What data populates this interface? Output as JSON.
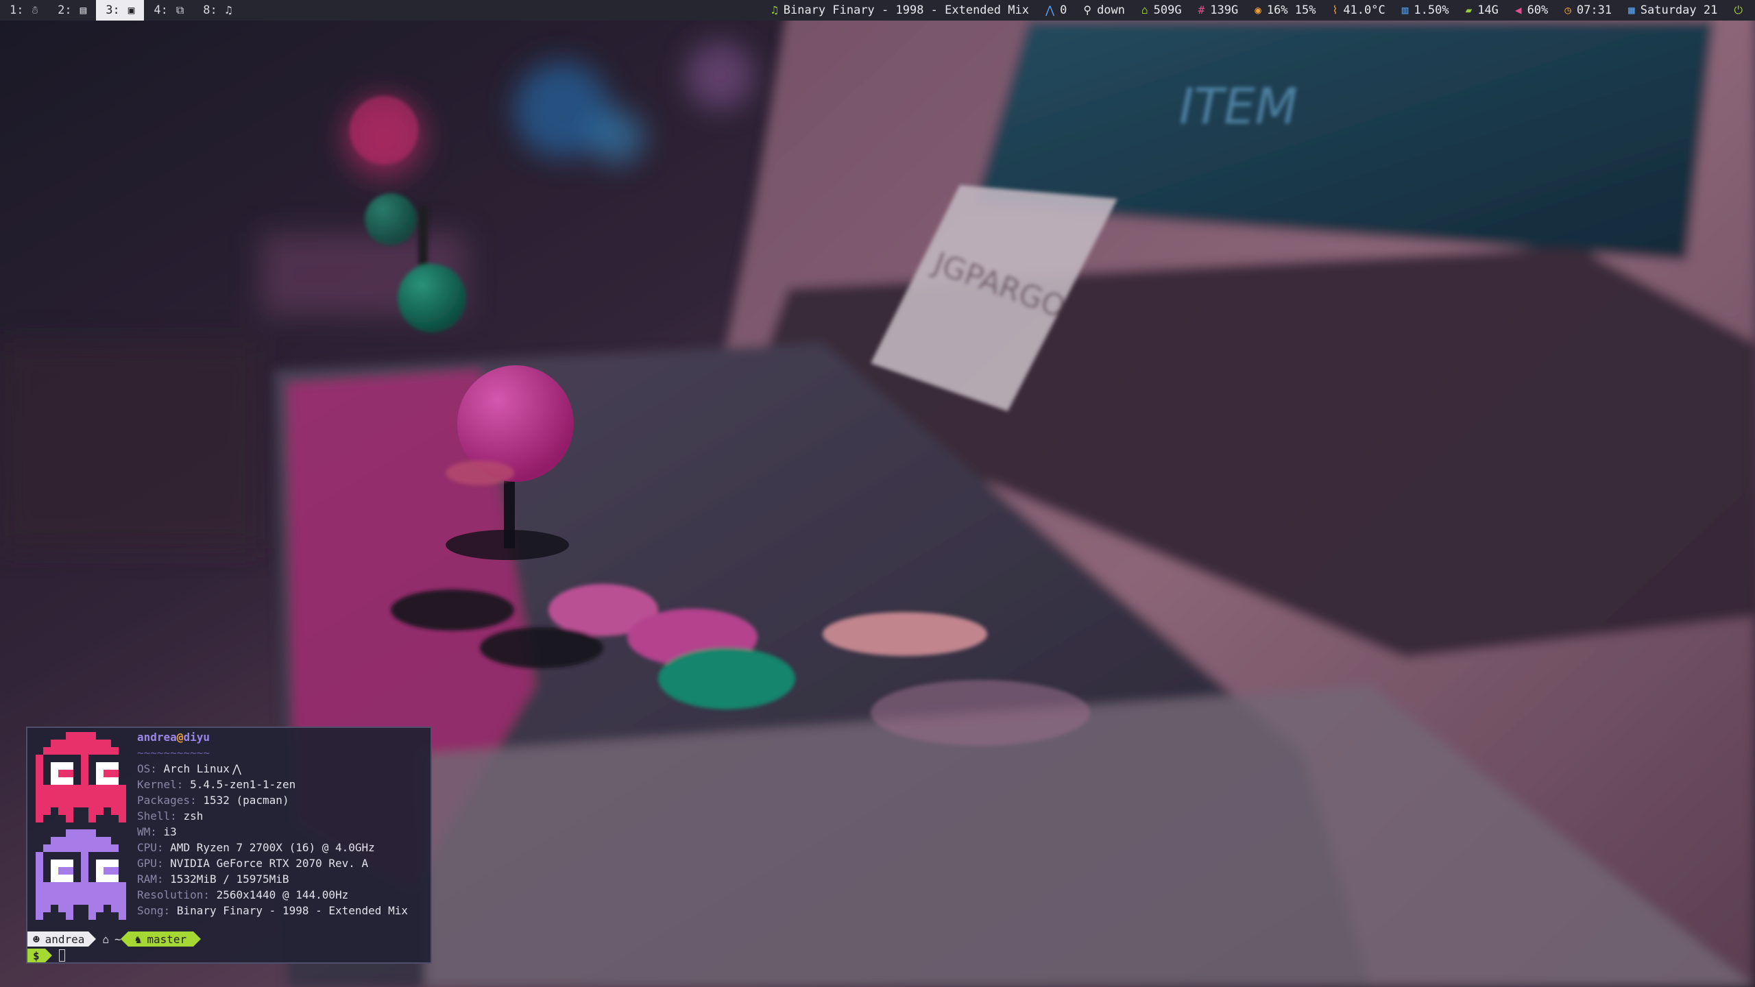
{
  "bar": {
    "workspaces": [
      {
        "label": "1:",
        "icon": "ghost-icon",
        "glyph": "☃",
        "focused": false
      },
      {
        "label": "2:",
        "icon": "document-icon",
        "glyph": "▤",
        "focused": false
      },
      {
        "label": "3:",
        "icon": "terminal-icon",
        "glyph": "▣",
        "focused": true
      },
      {
        "label": "4:",
        "icon": "copy-icon",
        "glyph": "⧉",
        "focused": false
      },
      {
        "label": "8:",
        "icon": "music-note-icon",
        "glyph": "♫",
        "focused": false
      }
    ],
    "status": {
      "song": "Binary Finary - 1998 - Extended Mix",
      "updates": "0",
      "network": "down",
      "disk_root": "509G",
      "disk_home": "139G",
      "cpu": "16% 15%",
      "temperature": "41.0°C",
      "load": "1.50%",
      "memory": "14G",
      "volume": "60%",
      "time": "07:31",
      "date": "Saturday 21"
    },
    "icons": {
      "song": "♫",
      "updates": "⋀",
      "network": "⚲",
      "disk_root": "⌂",
      "disk_home": "#",
      "cpu": "◉",
      "temperature": "⌇",
      "load": "▥",
      "memory": "▰",
      "volume": "◀",
      "time": "◷",
      "date": "▦",
      "power": "⏻"
    },
    "colors": {
      "song": "#9acb3c",
      "updates": "#5aa0e8",
      "network": "#e8e8ec",
      "disk_root": "#9acb3c",
      "disk_home": "#e05090",
      "cpu": "#f0a030",
      "temperature": "#f0a030",
      "load": "#5aa0e8",
      "memory": "#9acb3c",
      "volume": "#e05090",
      "time": "#f0a030",
      "date": "#5aa0e8",
      "power": "#9acb3c"
    }
  },
  "terminal": {
    "user": "andrea",
    "at": "@",
    "host": "diyu",
    "separator": "~~~~~~~~~~~",
    "info": [
      {
        "key": "OS:",
        "value": "Arch Linux"
      },
      {
        "key": "Kernel:",
        "value": "5.4.5-zen1-1-zen"
      },
      {
        "key": "Packages:",
        "value": "1532 (pacman)"
      },
      {
        "key": "Shell:",
        "value": "zsh"
      },
      {
        "key": "WM:",
        "value": "i3"
      },
      {
        "key": "CPU:",
        "value": "AMD Ryzen 7 2700X (16) @ 4.0GHz"
      },
      {
        "key": "GPU:",
        "value": "NVIDIA GeForce RTX 2070 Rev. A"
      },
      {
        "key": "RAM:",
        "value": "1532MiB / 15975MiB"
      },
      {
        "key": "Resolution:",
        "value": "2560x1440 @ 144.00Hz"
      },
      {
        "key": "Song:",
        "value": "Binary Finary - 1998 - Extended Mix"
      }
    ],
    "arch_glyph": "⋀",
    "prompt": {
      "user": "andrea",
      "user_glyph": "☻",
      "dir_glyph": "⌂",
      "dir": "~",
      "git_glyph": "♞",
      "branch": "master",
      "symbol": "$"
    },
    "sprite_colors": [
      "#e8306a",
      "#a77ce8"
    ]
  }
}
